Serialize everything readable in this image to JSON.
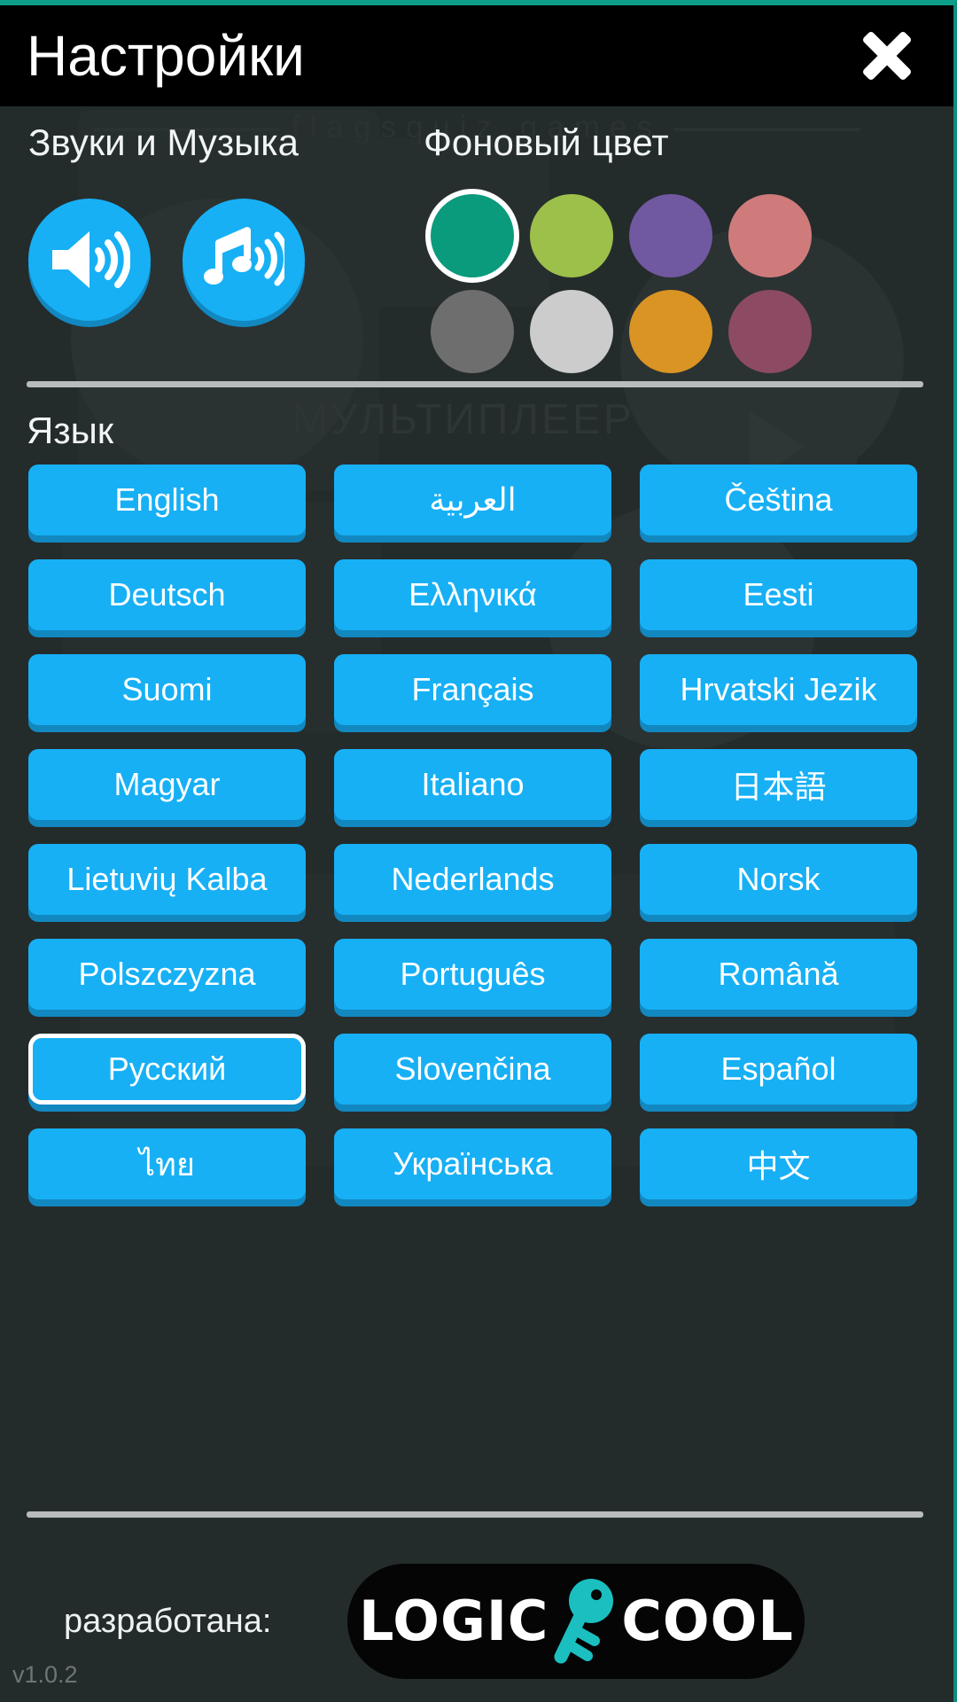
{
  "window": {
    "title": "Настройки",
    "close_label": "✕",
    "accent_top": "#0d9e8a"
  },
  "background_watermark": {
    "site": "flagsquiz.games",
    "multiplayer": "МУЛЬТИПЛЕЕР"
  },
  "sound_section": {
    "title": "Звуки и Музыка",
    "buttons": [
      {
        "name": "sound-toggle",
        "icon": "speaker-on-icon",
        "enabled": true
      },
      {
        "name": "music-toggle",
        "icon": "music-note-on-icon",
        "enabled": true
      }
    ]
  },
  "color_section": {
    "title": "Фоновый цвет",
    "selected_index": 0,
    "swatches": [
      {
        "name": "teal",
        "hex": "#0a9a7c"
      },
      {
        "name": "yellow-green",
        "hex": "#9dc04a"
      },
      {
        "name": "purple",
        "hex": "#7059a0"
      },
      {
        "name": "rose",
        "hex": "#cf7b7b"
      },
      {
        "name": "gray",
        "hex": "#6e6e6e"
      },
      {
        "name": "light-gray",
        "hex": "#cccccc"
      },
      {
        "name": "amber",
        "hex": "#d99423"
      },
      {
        "name": "plum",
        "hex": "#8d4a63"
      }
    ]
  },
  "language_section": {
    "title": "Язык",
    "selected": "Русский",
    "languages": [
      "English",
      "العربية",
      "Čeština",
      "Deutsch",
      "Ελληνικά",
      "Eesti",
      "Suomi",
      "Français",
      "Hrvatski Jezik",
      "Magyar",
      "Italiano",
      "日本語",
      "Lietuvių Kalba",
      "Nederlands",
      "Norsk",
      "Polszczyzna",
      "Português",
      "Română",
      "Русский",
      "Slovenčina",
      "Español",
      "ไทย",
      "Українська",
      "中文"
    ]
  },
  "footer": {
    "developed_by_label": "разработана:",
    "logo": {
      "left_text": "LOGIC",
      "right_text": "COOL",
      "icon": "key-icon",
      "icon_color": "#1bbfc0"
    },
    "version": "v1.0.2"
  }
}
